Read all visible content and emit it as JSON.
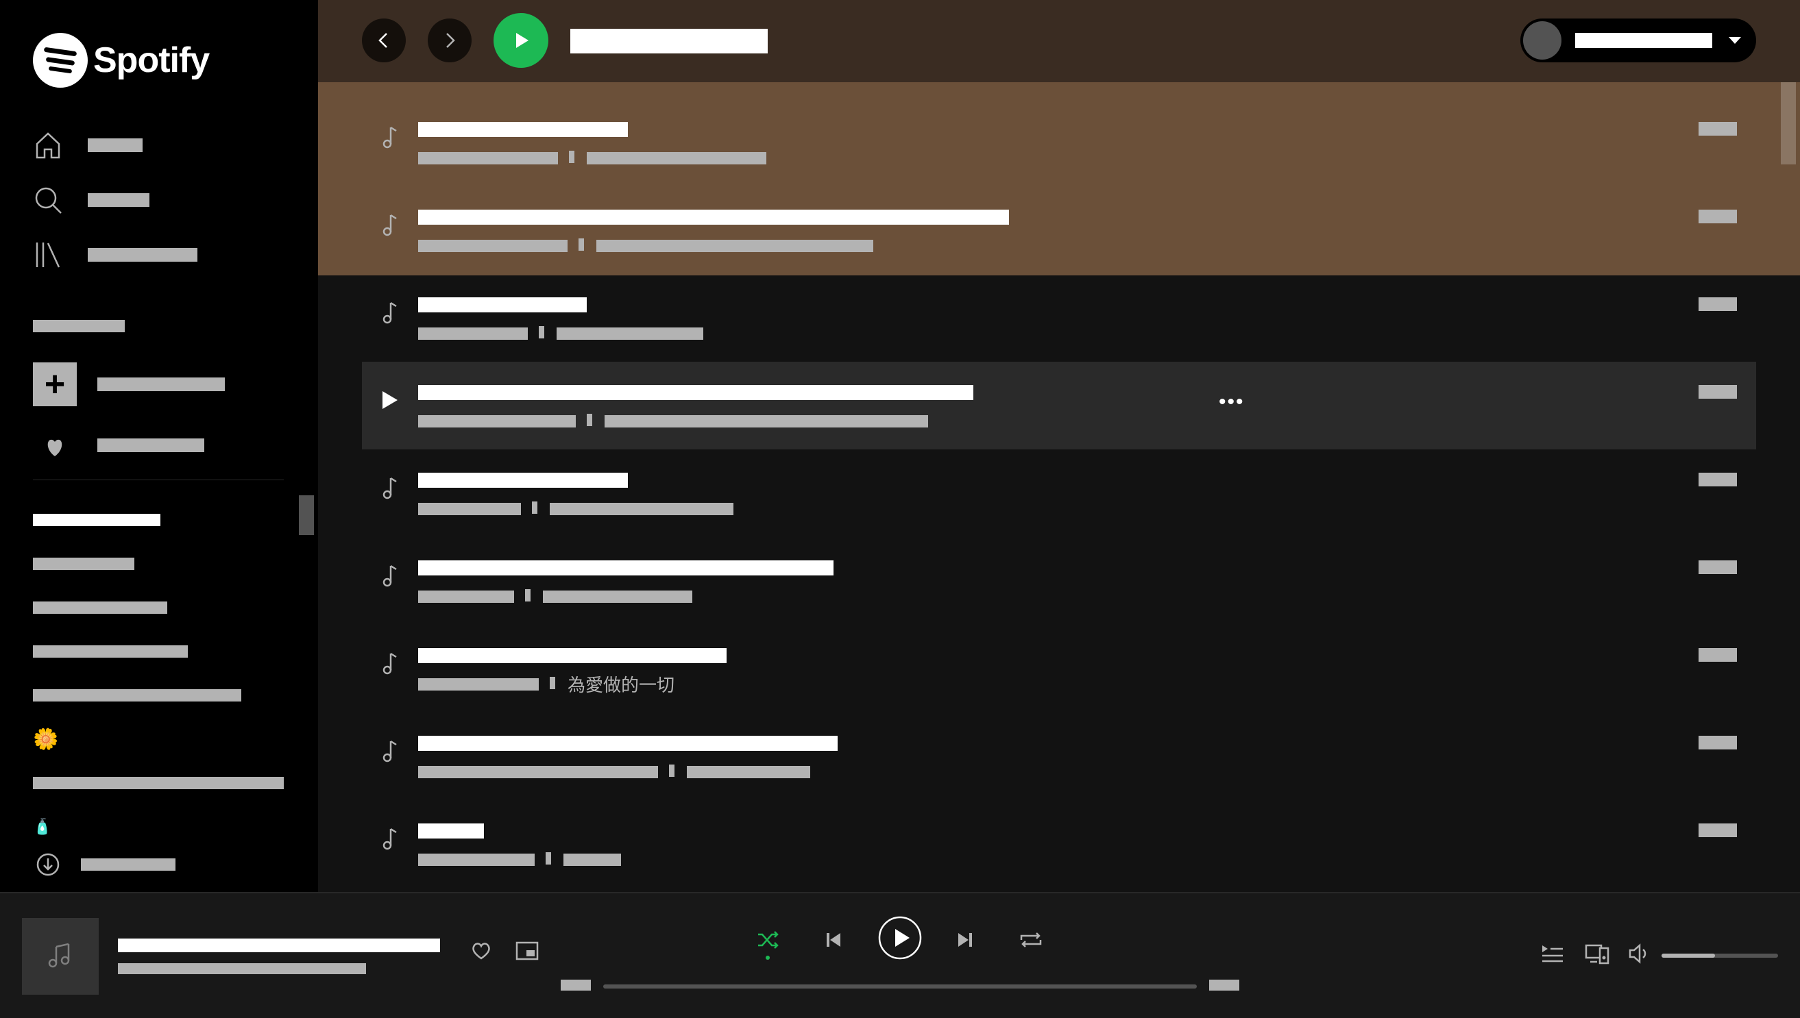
{
  "app": {
    "name": "Spotify"
  },
  "sidebar": {
    "nav": [
      {
        "id": "home",
        "icon": "home-icon"
      },
      {
        "id": "search",
        "icon": "search-icon"
      },
      {
        "id": "library",
        "icon": "library-icon"
      }
    ],
    "playlists_heading": "",
    "create_playlist": {
      "icon": "plus-icon"
    },
    "liked_songs": {
      "icon": "heart-icon"
    },
    "playlists": [
      {
        "icon": null
      },
      {
        "icon": null
      },
      {
        "icon": null
      },
      {
        "icon": null
      },
      {
        "icon": null
      },
      {
        "icon": "flower-emoji",
        "emoji": "🌼"
      },
      {
        "icon": null
      },
      {
        "icon": "bottle-emoji",
        "emoji": "🧴"
      }
    ],
    "install_app": {
      "icon": "download-icon"
    }
  },
  "topbar": {
    "back_icon": "chevron-left-icon",
    "forward_icon": "chevron-right-icon",
    "play_icon": "play-icon",
    "user_menu_icon": "caret-down-icon",
    "header_color": "#6b5039",
    "topbar_color": "#3a2c22"
  },
  "tracks": [
    {
      "album_text": ""
    },
    {
      "album_text": ""
    },
    {
      "album_text": ""
    },
    {
      "album_text": "",
      "hovered": true
    },
    {
      "album_text": ""
    },
    {
      "album_text": ""
    },
    {
      "album_text": "為愛做的一切"
    },
    {
      "album_text": ""
    },
    {
      "album_text": ""
    }
  ],
  "player": {
    "shuffle_active": true,
    "icons": [
      "shuffle-icon",
      "skip-back-icon",
      "play-icon",
      "skip-forward-icon",
      "repeat-icon",
      "heart-icon",
      "picture-in-picture-icon",
      "queue-icon",
      "devices-icon",
      "volume-icon"
    ],
    "volume_level": 0.46,
    "progress": 0,
    "accent_color": "#1db954"
  }
}
